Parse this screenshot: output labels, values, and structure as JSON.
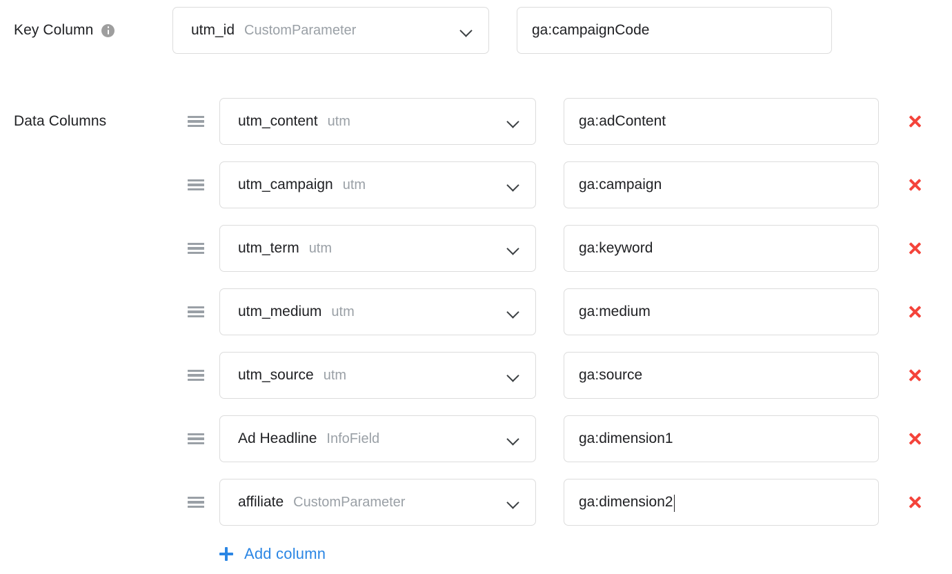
{
  "key_column": {
    "label": "Key Column",
    "info_icon": "info-icon",
    "select": {
      "primary": "utm_id",
      "secondary": "CustomParameter",
      "chevron_icon": "chevron-down-icon"
    },
    "mapping_value": "ga:campaignCode"
  },
  "data_columns": {
    "label": "Data Columns",
    "drag_icon": "drag-handle-icon",
    "delete_icon": "close-icon",
    "rows": [
      {
        "primary": "utm_content",
        "secondary": "utm",
        "mapping_value": "ga:adContent",
        "focused": false
      },
      {
        "primary": "utm_campaign",
        "secondary": "utm",
        "mapping_value": "ga:campaign",
        "focused": false
      },
      {
        "primary": "utm_term",
        "secondary": "utm",
        "mapping_value": "ga:keyword",
        "focused": false
      },
      {
        "primary": "utm_medium",
        "secondary": "utm",
        "mapping_value": "ga:medium",
        "focused": false
      },
      {
        "primary": "utm_source",
        "secondary": "utm",
        "mapping_value": "ga:source",
        "focused": false
      },
      {
        "primary": "Ad Headline",
        "secondary": "InfoField",
        "mapping_value": "ga:dimension1",
        "focused": false
      },
      {
        "primary": "affiliate",
        "secondary": "CustomParameter",
        "mapping_value": "ga:dimension2",
        "focused": true
      }
    ]
  },
  "add_column": {
    "label": "Add column",
    "plus_icon": "plus-icon"
  },
  "colors": {
    "accent_link": "#2b86e4",
    "delete": "#f4433a",
    "text_primary": "#202124",
    "text_secondary": "#9aa0a6",
    "border": "#dcdcdc"
  }
}
